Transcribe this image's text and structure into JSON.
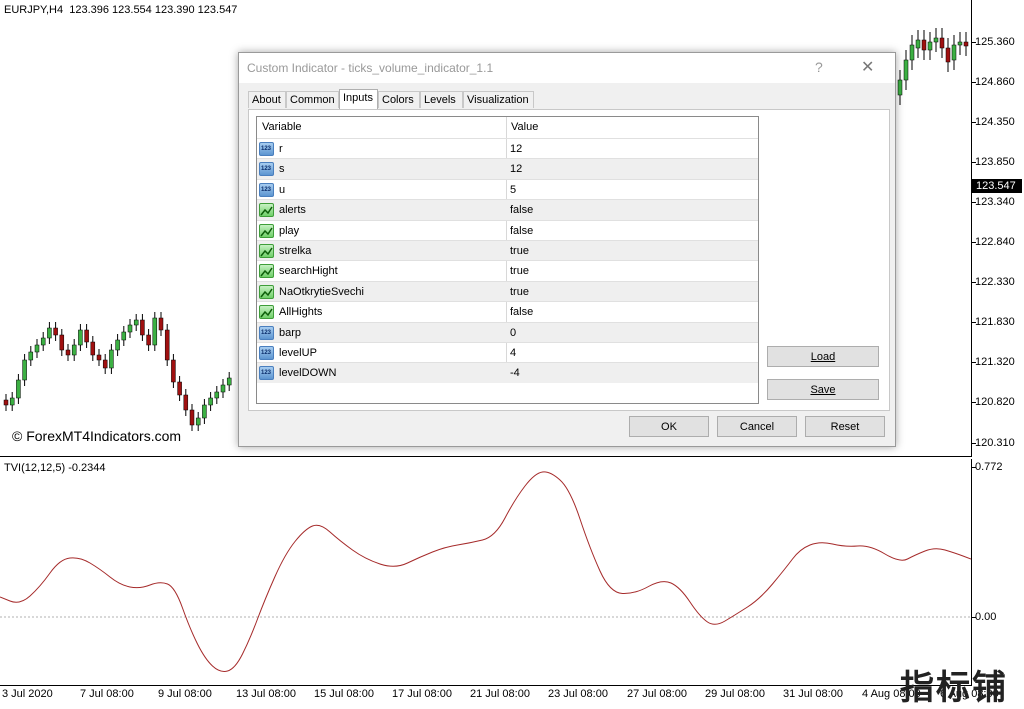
{
  "chart": {
    "header": "EURJPY,H4  123.396 123.554 123.390 123.547",
    "watermark": "© ForexMT4Indicators.com",
    "current_price": "123.547",
    "price_labels": [
      "125.360",
      "124.860",
      "124.350",
      "123.850",
      "123.340",
      "122.840",
      "122.330",
      "121.830",
      "121.320",
      "120.820",
      "120.310"
    ]
  },
  "indicator": {
    "header": "TVI(12,12,5) -0.2344",
    "axis_top": "0.772",
    "axis_zero": "0.00"
  },
  "time_labels": [
    "3 Jul 2020",
    "7 Jul 08:00",
    "9 Jul 08:00",
    "13 Jul 08:00",
    "15 Jul 08:00",
    "17 Jul 08:00",
    "21 Jul 08:00",
    "23 Jul 08:00",
    "27 Jul 08:00",
    "29 Jul 08:00",
    "31 Jul 08:00",
    "4 Aug 08:00",
    "6 Aug 08:00"
  ],
  "corner_logo": "指标铺",
  "dialog": {
    "title": "Custom Indicator - ticks_volume_indicator_1.1",
    "help": "?",
    "close": "✕",
    "tabs": [
      "About",
      "Common",
      "Inputs",
      "Colors",
      "Levels",
      "Visualization"
    ],
    "active_tab": "Inputs",
    "grid": {
      "col_variable": "Variable",
      "col_value": "Value",
      "rows": [
        {
          "icon": "numeric-icon",
          "icon_text": "123",
          "variable": "r",
          "value": "12"
        },
        {
          "icon": "numeric-icon",
          "icon_text": "123",
          "variable": "s",
          "value": "12"
        },
        {
          "icon": "numeric-icon",
          "icon_text": "123",
          "variable": "u",
          "value": "5"
        },
        {
          "icon": "boolean-icon",
          "variable": "alerts",
          "value": "false"
        },
        {
          "icon": "boolean-icon",
          "variable": "play",
          "value": "false"
        },
        {
          "icon": "boolean-icon",
          "variable": "strelka",
          "value": "true"
        },
        {
          "icon": "boolean-icon",
          "variable": "searchHight",
          "value": "true"
        },
        {
          "icon": "boolean-icon",
          "variable": "NaOtkrytieSvechi",
          "value": "true"
        },
        {
          "icon": "boolean-icon",
          "variable": "AllHights",
          "value": "false"
        },
        {
          "icon": "numeric-icon",
          "icon_text": "123",
          "variable": "barp",
          "value": "0"
        },
        {
          "icon": "numeric-icon",
          "icon_text": "123",
          "variable": "levelUP",
          "value": "4"
        },
        {
          "icon": "numeric-icon",
          "icon_text": "123",
          "variable": "levelDOWN",
          "value": "-4"
        }
      ]
    },
    "buttons": {
      "load": "Load",
      "save": "Save",
      "ok": "OK",
      "cancel": "Cancel",
      "reset": "Reset"
    }
  }
}
